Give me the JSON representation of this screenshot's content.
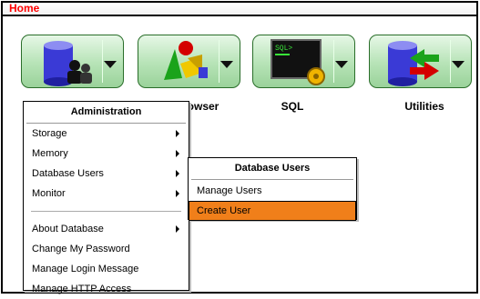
{
  "title": "Home",
  "tiles": [
    {
      "label": "Administration",
      "icon": "database-users-icon"
    },
    {
      "label": "Object Browser",
      "icon": "object-browser-icon"
    },
    {
      "label": "SQL",
      "icon": "sql-terminal-icon"
    },
    {
      "label": "Utilities",
      "icon": "database-utilities-icon"
    }
  ],
  "visible_labels": {
    "browser": "rowser",
    "sql": "SQL",
    "utilities": "Utilities"
  },
  "admin_menu": {
    "title": "Administration",
    "items": [
      "Storage",
      "Memory",
      "Database Users",
      "Monitor",
      "About Database",
      "Change My Password",
      "Manage Login Message",
      "Manage HTTP Access"
    ]
  },
  "users_menu": {
    "title": "Database Users",
    "items": [
      "Manage Users",
      "Create User"
    ]
  },
  "colors": {
    "title": "#ff0000",
    "highlight": "#f07f1a",
    "tile_green": "#b6e3b6"
  }
}
